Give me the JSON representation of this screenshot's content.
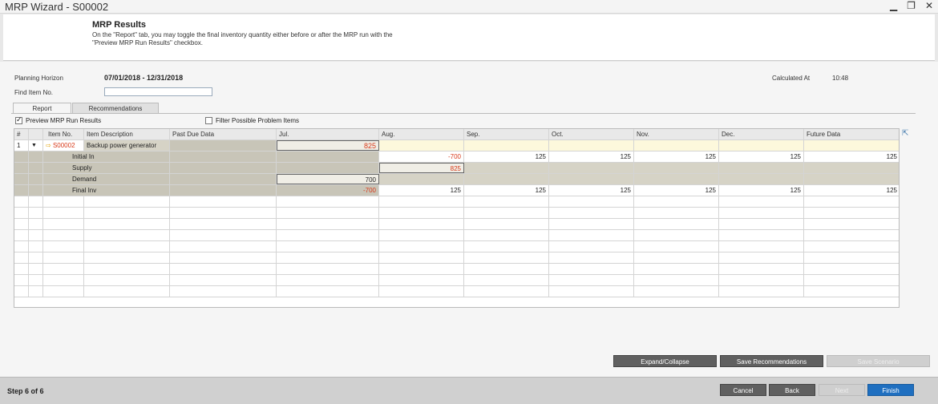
{
  "window": {
    "title": "MRP Wizard - S00002",
    "minimize": "▁",
    "restore": "❐",
    "close": "✕"
  },
  "banner": {
    "title": "MRP Results",
    "desc": "On the \"Report\" tab, you may toggle the final inventory quantity either before or after the MRP run with the \"Preview MRP Run Results\" checkbox."
  },
  "header": {
    "planning_label": "Planning Horizon",
    "planning_value": "07/01/2018 -  12/31/2018",
    "find_label": "Find Item No.",
    "find_value": "",
    "calc_label": "Calculated At",
    "calc_value": "10:48"
  },
  "tabs": [
    "Report",
    "Recommendations"
  ],
  "options": {
    "preview": "Preview MRP Run Results",
    "filter": "Filter Possible Problem Items"
  },
  "table": {
    "columns": [
      "#",
      "",
      "Item No.",
      "Item Description",
      "Past Due Data",
      "Jul.",
      "Aug.",
      "Sep.",
      "Oct.",
      "Nov.",
      "Dec.",
      "Future Data"
    ],
    "item": {
      "num": "1",
      "arrow": "⇨",
      "item_no": "S00002",
      "desc": "Backup power generator",
      "jul": "825"
    },
    "rows": [
      {
        "label": "Initial In",
        "jul": "",
        "aug": "-700",
        "sep": "125",
        "oct": "125",
        "nov": "125",
        "dec": "125",
        "fut": "125"
      },
      {
        "label": "Supply",
        "jul": "",
        "aug": "825",
        "sep": "",
        "oct": "",
        "nov": "",
        "dec": "",
        "fut": ""
      },
      {
        "label": "Demand",
        "jul": "700",
        "aug": "",
        "sep": "",
        "oct": "",
        "nov": "",
        "dec": "",
        "fut": ""
      },
      {
        "label": "Final Inv",
        "jul": "-700",
        "aug": "125",
        "sep": "125",
        "oct": "125",
        "nov": "125",
        "dec": "125",
        "fut": "125"
      }
    ]
  },
  "buttons": {
    "expand": "Expand/Collapse",
    "save_rec": "Save Recommendations",
    "save_scen": "Save Scenario",
    "cancel": "Cancel",
    "back": "Back",
    "next": "Next",
    "finish": "Finish"
  },
  "footer": {
    "step": "Step 6 of 6"
  }
}
